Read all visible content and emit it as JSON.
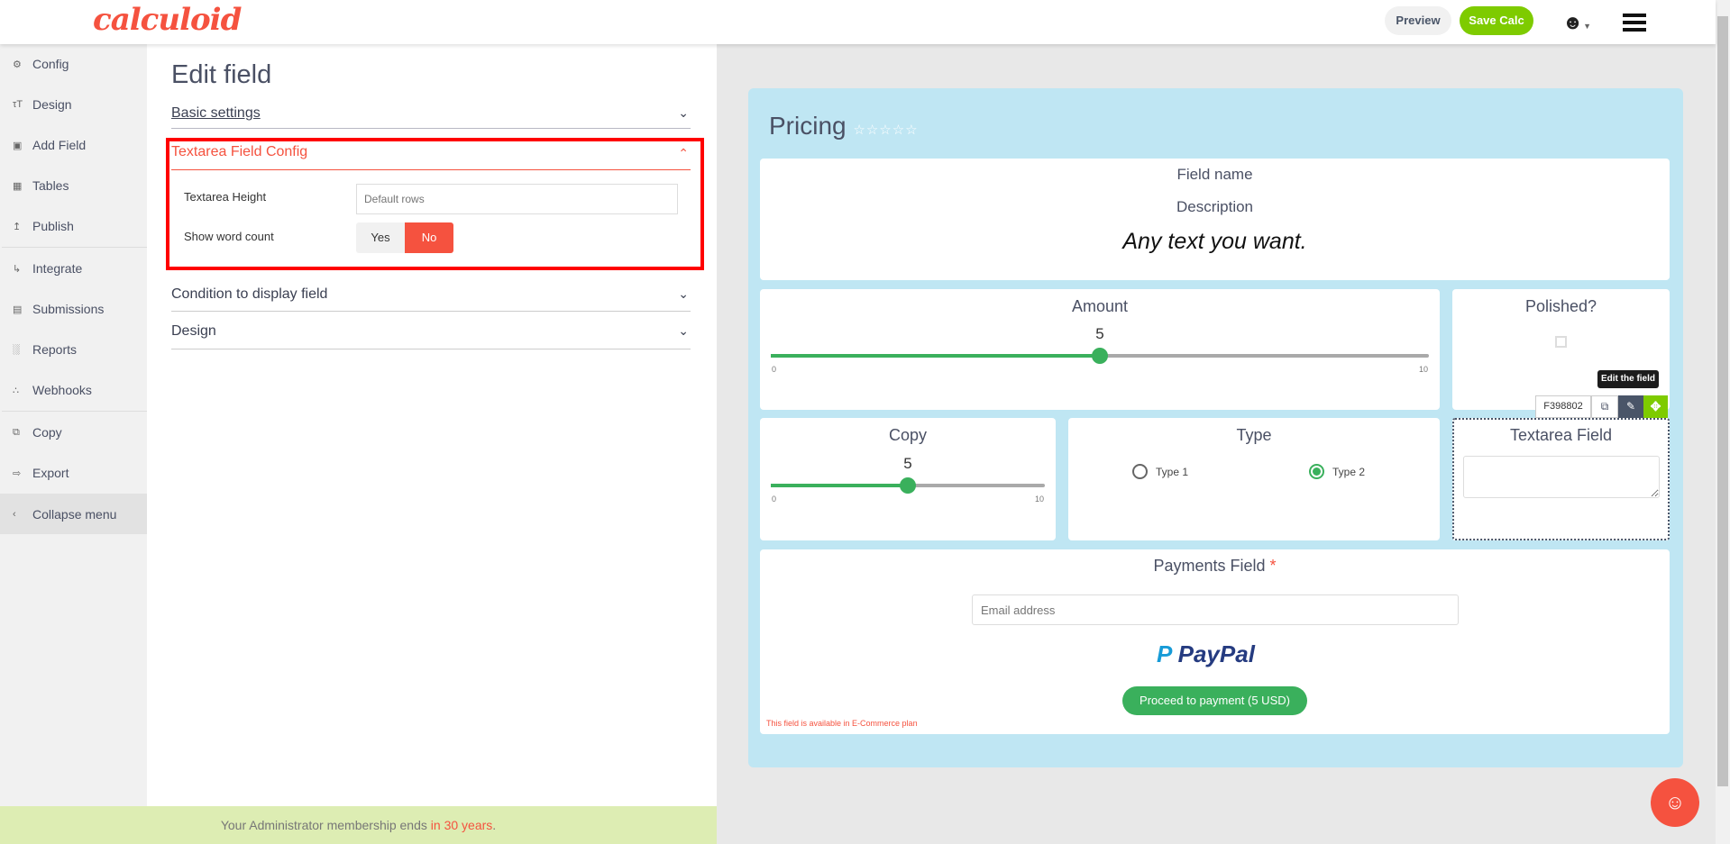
{
  "header": {
    "logo": "calculoid",
    "preview_label": "Preview",
    "save_label": "Save Calc"
  },
  "sidebar": {
    "items": [
      {
        "label": "Config",
        "icon": "gear-icon"
      },
      {
        "label": "Design",
        "icon": "text-size-icon"
      },
      {
        "label": "Add Field",
        "icon": "plus-square-icon"
      },
      {
        "label": "Tables",
        "icon": "table-icon"
      },
      {
        "label": "Publish",
        "icon": "upload-icon"
      },
      {
        "label": "Integrate",
        "icon": "integrate-icon"
      },
      {
        "label": "Submissions",
        "icon": "inbox-icon"
      },
      {
        "label": "Reports",
        "icon": "bar-chart-icon"
      },
      {
        "label": "Webhooks",
        "icon": "webhooks-icon"
      },
      {
        "label": "Copy",
        "icon": "copy-icon"
      },
      {
        "label": "Export",
        "icon": "export-icon"
      },
      {
        "label": "Collapse menu",
        "icon": "chevron-left-icon"
      }
    ]
  },
  "editor": {
    "title": "Edit field",
    "sections": {
      "basic": "Basic settings",
      "textarea_config": "Textarea Field Config",
      "condition": "Condition to display field",
      "design": "Design"
    },
    "textarea_height_label": "Textarea Height",
    "textarea_height_placeholder": "Default rows",
    "word_count_label": "Show word count",
    "yes": "Yes",
    "no": "No",
    "word_count_selected": "No"
  },
  "footer": {
    "text": "Your Administrator membership ends ",
    "highlight": "in 30 years",
    "end": "."
  },
  "preview": {
    "title": "Pricing",
    "rating": 0,
    "rating_max": 5,
    "field1": {
      "name": "Field name",
      "description": "Description",
      "text": "Any text you want."
    },
    "amount": {
      "label": "Amount",
      "value": "5",
      "min": "0",
      "max": "10"
    },
    "polished": {
      "label": "Polished?",
      "checked": false
    },
    "toolbar": {
      "id": "F398802",
      "tooltip": "Edit the field"
    },
    "copy": {
      "label": "Copy",
      "value": "5",
      "min": "0",
      "max": "10"
    },
    "type": {
      "label": "Type",
      "options": [
        "Type 1",
        "Type 2"
      ],
      "selected": "Type 2"
    },
    "textarea": {
      "label": "Textarea Field"
    },
    "payments": {
      "label": "Payments Field",
      "required": "*",
      "email_placeholder": "Email address",
      "paypal": "PayPal",
      "button": "Proceed to payment (5 USD)",
      "note": "This field is available in E-Commerce plan"
    }
  },
  "colors": {
    "accent": "#f5523f",
    "green": "#7ecb00",
    "slider": "#3ab05c",
    "card": "#bfe6f3"
  }
}
